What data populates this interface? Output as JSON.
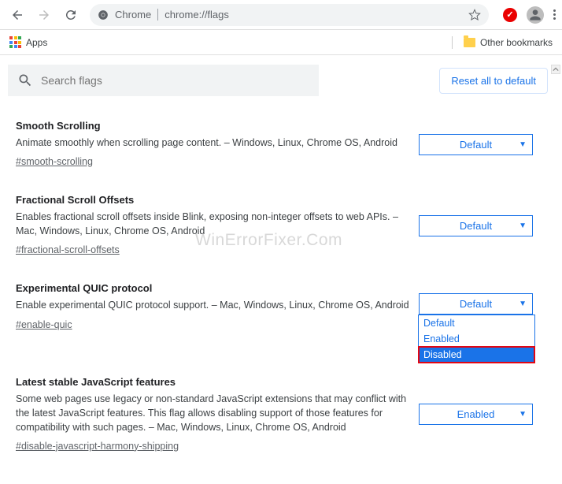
{
  "toolbar": {
    "title_label": "Chrome",
    "url": "chrome://flags"
  },
  "bookmarks": {
    "apps_label": "Apps",
    "other_label": "Other bookmarks"
  },
  "search": {
    "placeholder": "Search flags",
    "reset_label": "Reset all to default"
  },
  "flags": [
    {
      "title": "Smooth Scrolling",
      "desc": "Animate smoothly when scrolling page content. – Windows, Linux, Chrome OS, Android",
      "anchor": "#smooth-scrolling",
      "value": "Default"
    },
    {
      "title": "Fractional Scroll Offsets",
      "desc": "Enables fractional scroll offsets inside Blink, exposing non-integer offsets to web APIs. – Mac, Windows, Linux, Chrome OS, Android",
      "anchor": "#fractional-scroll-offsets",
      "value": "Default"
    },
    {
      "title": "Experimental QUIC protocol",
      "desc": "Enable experimental QUIC protocol support. – Mac, Windows, Linux, Chrome OS, Android",
      "anchor": "#enable-quic",
      "value": "Default",
      "dropdown_open": true,
      "options": [
        "Default",
        "Enabled",
        "Disabled"
      ],
      "selected_option": "Disabled"
    },
    {
      "title": "Latest stable JavaScript features",
      "desc": "Some web pages use legacy or non-standard JavaScript extensions that may conflict with the latest JavaScript features. This flag allows disabling support of those features for compatibility with such pages. – Mac, Windows, Linux, Chrome OS, Android",
      "anchor": "#disable-javascript-harmony-shipping",
      "value": "Enabled"
    }
  ],
  "watermark": "WinErrorFixer.Com"
}
